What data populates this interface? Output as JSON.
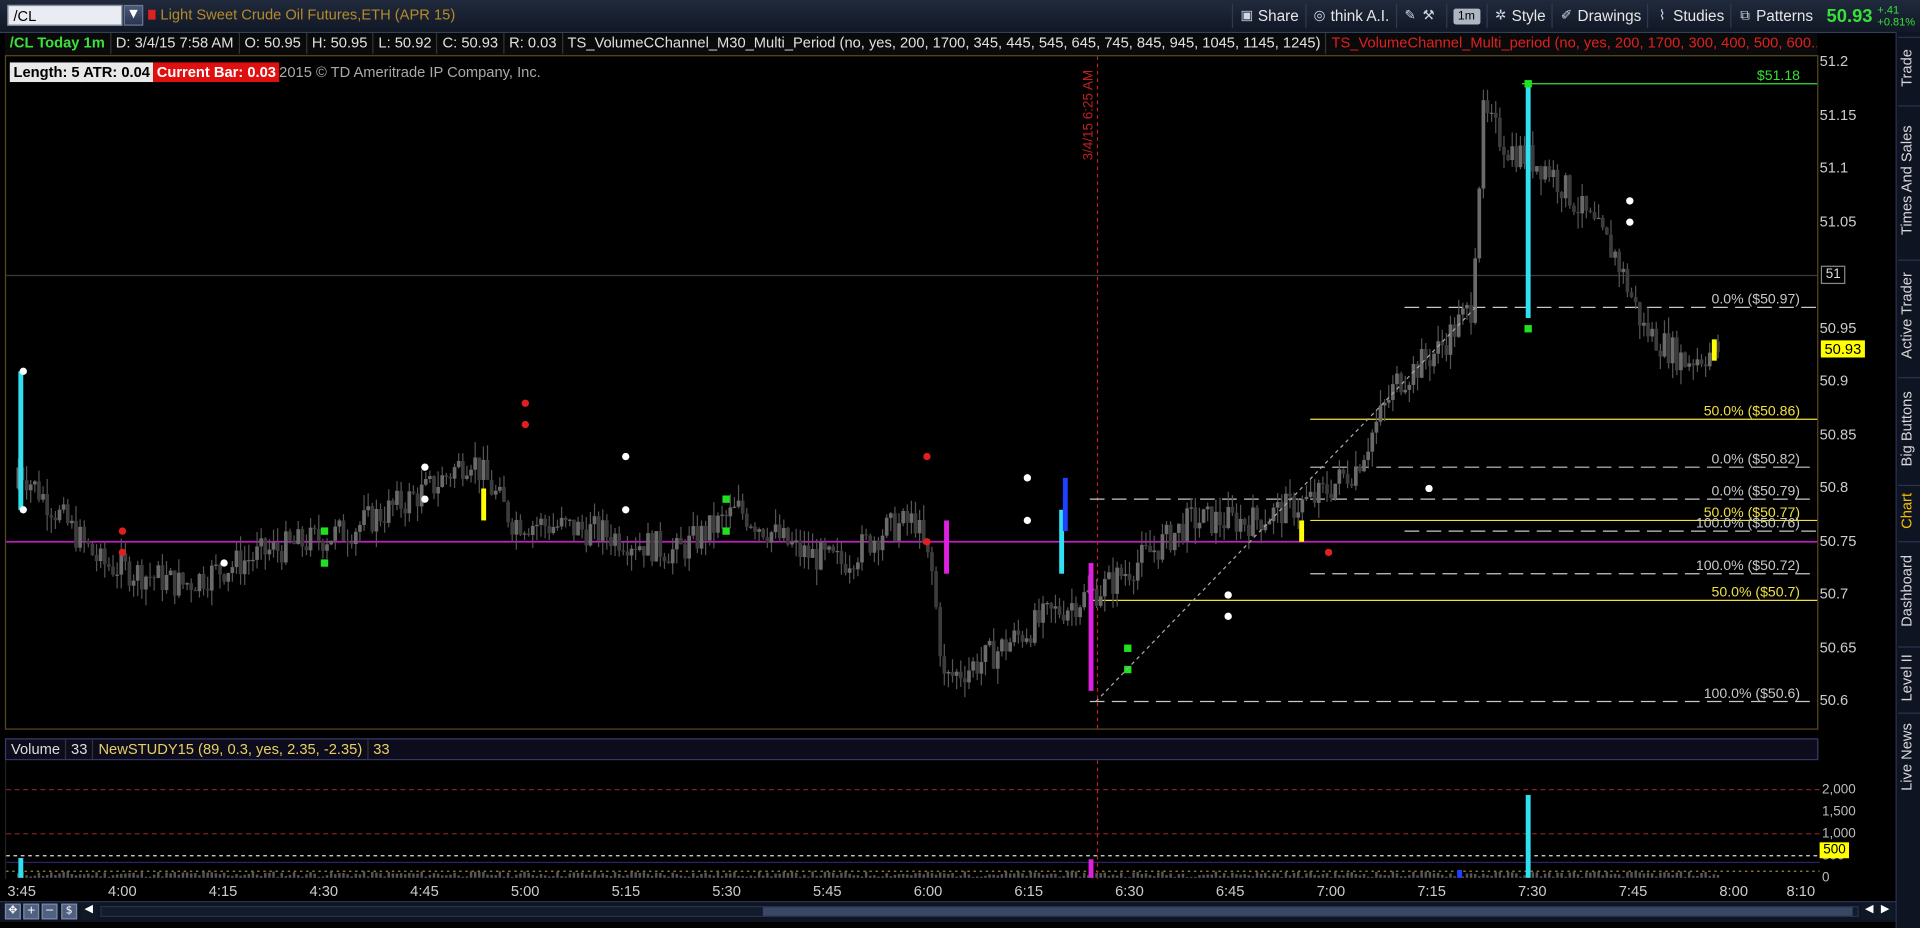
{
  "topbar": {
    "symbol": "/CL",
    "description": "Light Sweet Crude Oil Futures,ETH (APR 15)",
    "buttons": [
      {
        "label": "Share",
        "icon": "share-icon"
      },
      {
        "label": "think A.I.",
        "icon": "thinkai-icon"
      },
      {
        "label": "",
        "icon": "tools-icon"
      },
      {
        "label": "1m",
        "icon": "timeframe-icon"
      },
      {
        "label": "Style",
        "icon": "style-icon"
      },
      {
        "label": "Drawings",
        "icon": "drawings-icon"
      },
      {
        "label": "Studies",
        "icon": "studies-icon"
      },
      {
        "label": "Patterns",
        "icon": "patterns-icon"
      }
    ],
    "last_price": "50.93",
    "change_abs": "+.41",
    "change_pct": "+0.81%"
  },
  "infobar": {
    "symbol_tf": "/CL Today 1m",
    "date": "D: 3/4/15 7:58 AM",
    "open": "O: 50.95",
    "high": "H: 50.95",
    "low": "L: 50.92",
    "close": "C: 50.93",
    "range": "R: 0.03",
    "study1": "TS_VolumeCChannel_M30_Multi_Period (no, yes, 200, 1700, 345, 445, 545, 645, 745, 845, 945, 1045, 1145, 1245)",
    "study2": "TS_VolumeChannel_Multi_period (no, yes, 200, 1700, 300, 400, 500, 600..."
  },
  "labels": {
    "length": "Length: 5",
    "atr": "ATR: 0.04",
    "current_bar": "Current Bar: 0.03",
    "copyright": "2015 © TD Ameritrade IP Company, Inc.",
    "vertical_marker": "3/4/15 6:25 AM",
    "max_price": "$51.18",
    "price_tag_51": "51",
    "last_tag": "50.93"
  },
  "price_axis": [
    "51.2",
    "51.15",
    "51.1",
    "51.05",
    "50.95",
    "50.9",
    "50.85",
    "50.8",
    "50.75",
    "50.7",
    "50.65",
    "50.6"
  ],
  "fib_levels": [
    {
      "text": "0.0%  ($50.97)",
      "price": 50.97,
      "color": "#c8c8c8"
    },
    {
      "text": "50.0%  ($50.86)",
      "price": 50.865,
      "color": "#f0e040"
    },
    {
      "text": "0.0%  ($50.82)",
      "price": 50.82,
      "color": "#c8c8c8"
    },
    {
      "text": "0.0%  ($50.79)",
      "price": 50.79,
      "color": "#c8c8c8"
    },
    {
      "text": "50.0%  ($50.77)",
      "price": 50.77,
      "color": "#f0e040"
    },
    {
      "text": "100.0%  ($50.76)",
      "price": 50.76,
      "color": "#c8c8c8"
    },
    {
      "text": "100.0%  ($50.72)",
      "price": 50.72,
      "color": "#c8c8c8"
    },
    {
      "text": "50.0%  ($50.7)",
      "price": 50.695,
      "color": "#f0e040"
    },
    {
      "text": "100.0%  ($50.6)",
      "price": 50.6,
      "color": "#c8c8c8"
    }
  ],
  "volume_bar": {
    "label": "Volume",
    "value": "33",
    "study": "NewSTUDY15 (89, 0.3, yes, 2.35, -2.35)",
    "study_value": "33",
    "tag": "500"
  },
  "volume_axis": [
    "2,000",
    "1,500",
    "1,000",
    "500",
    "0"
  ],
  "time_axis": [
    "3:45",
    "4:00",
    "4:15",
    "4:30",
    "4:45",
    "5:00",
    "5:15",
    "5:30",
    "5:45",
    "6:00",
    "6:15",
    "6:30",
    "6:45",
    "7:00",
    "7:15",
    "7:30",
    "7:45",
    "8:00",
    "8:10"
  ],
  "side_tabs": [
    {
      "label": "Trade",
      "active": false
    },
    {
      "label": "Times And Sales",
      "active": false
    },
    {
      "label": "Active Trader",
      "active": false
    },
    {
      "label": "Big Buttons",
      "active": false
    },
    {
      "label": "Chart",
      "active": true
    },
    {
      "label": "Dashboard",
      "active": false
    },
    {
      "label": "Level II",
      "active": false
    },
    {
      "label": "Live News",
      "active": false
    }
  ],
  "colors": {
    "up": "#38e038",
    "fib_yellow": "#f0e040",
    "magenta_line": "#c020c0",
    "cyan": "#30e0f0"
  }
}
